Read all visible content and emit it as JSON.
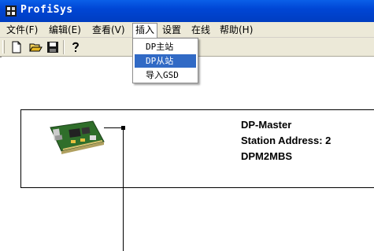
{
  "window": {
    "title": "ProfiSys"
  },
  "menu": {
    "items": [
      {
        "label": "文件(F)"
      },
      {
        "label": "编辑(E)"
      },
      {
        "label": "查看(V)"
      },
      {
        "label": "插入"
      },
      {
        "label": "设置"
      },
      {
        "label": "在线"
      },
      {
        "label": "帮助(H)"
      }
    ],
    "active_index": 3
  },
  "dropdown": {
    "items": [
      {
        "label": "DP主站"
      },
      {
        "label": "DP从站"
      },
      {
        "label": "导入GSD"
      }
    ],
    "selected_index": 1
  },
  "toolbar": {
    "buttons": [
      {
        "icon": "new-file-icon"
      },
      {
        "icon": "open-folder-icon"
      },
      {
        "icon": "save-disk-icon"
      },
      {
        "icon": "help-question-icon"
      }
    ]
  },
  "device": {
    "name": "DP-Master",
    "station_address": "Station Address: 2",
    "model": "DPM2MBS",
    "icon": "pci-card-icon"
  },
  "colors": {
    "titlebar": "#0046d5",
    "menu_bg": "#ece9d8",
    "highlight": "#316ac5"
  }
}
